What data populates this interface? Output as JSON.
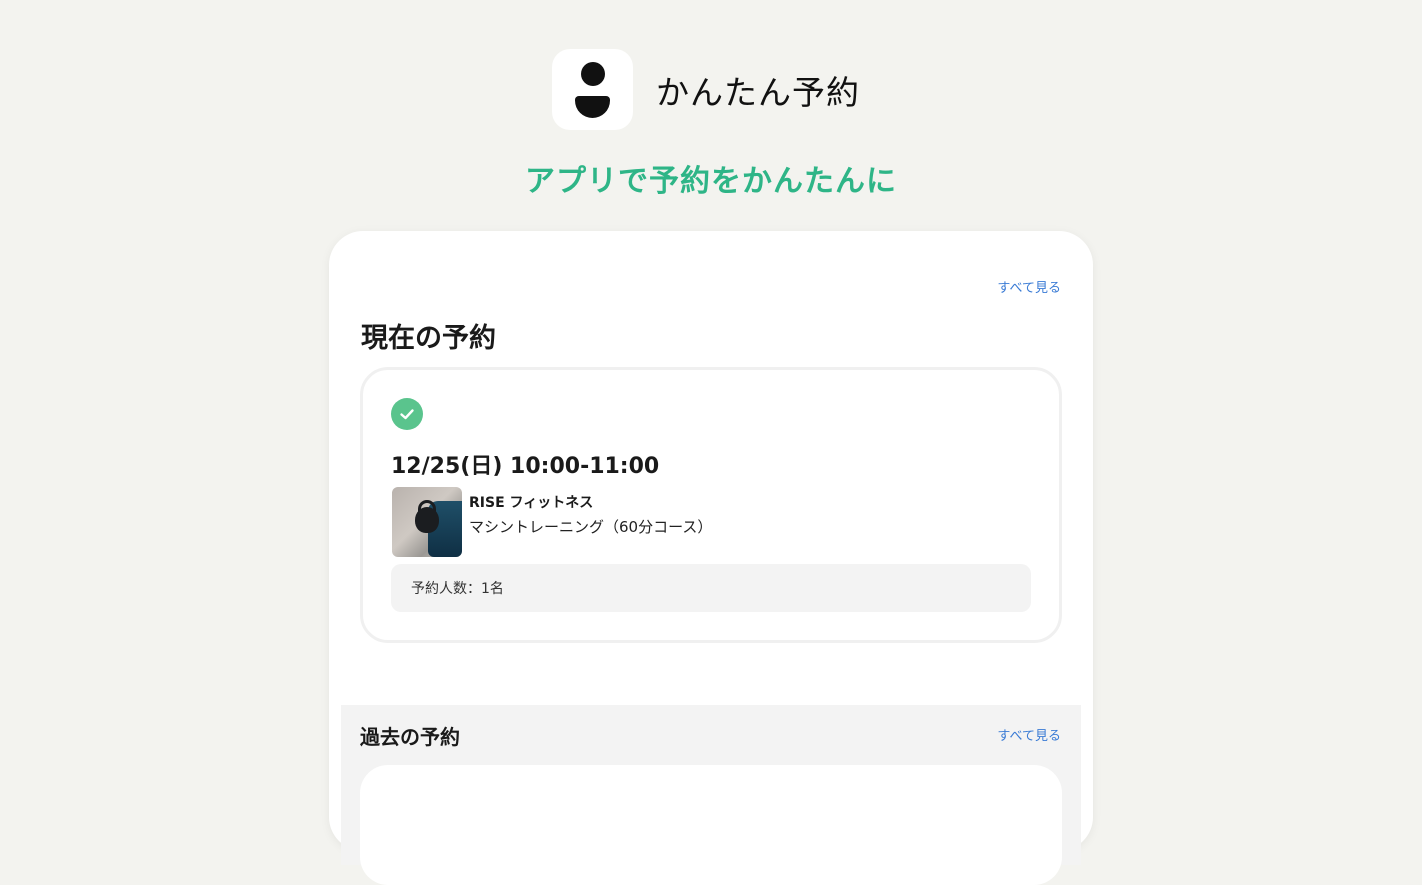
{
  "header": {
    "app_name": "かんたん予約",
    "tagline": "アプリで予約をかんたんに"
  },
  "current": {
    "see_all": "すべて見る",
    "title": "現在の予約",
    "booking": {
      "status_icon": "check-circle-icon",
      "datetime": "12/25(日) 10:00-11:00",
      "gym_name": "RISE フィットネス",
      "course": "マシントレーニング（60分コース）",
      "count_label": "予約人数：1名"
    }
  },
  "past": {
    "title": "過去の予約",
    "see_all": "すべて見る"
  },
  "colors": {
    "accent_green": "#2eb587",
    "check_green": "#5ac48d",
    "link_blue": "#3a7bd5",
    "background": "#f3f3ef"
  }
}
